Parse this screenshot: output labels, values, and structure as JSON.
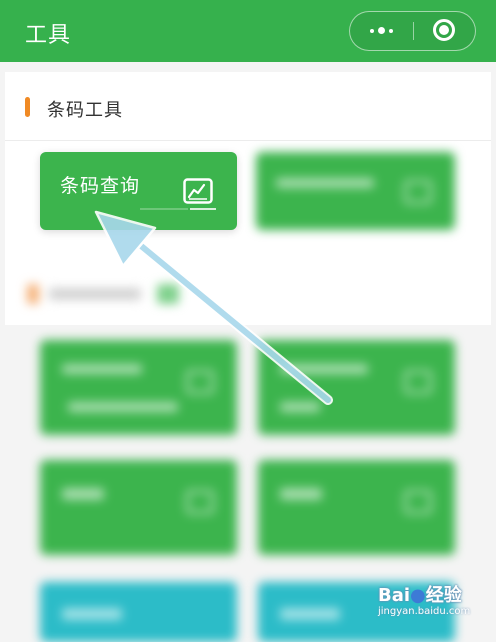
{
  "header": {
    "title": "工具",
    "more_icon": "more-dots-icon",
    "close_icon": "target-close-icon",
    "bg_color": "#36b14d"
  },
  "section": {
    "title": "条码工具",
    "accent_color": "#f08a24"
  },
  "cards": [
    {
      "label": "条码查询",
      "icon": "chart-icon",
      "color": "#3cb44d"
    }
  ],
  "annotation": {
    "arrow_color": "#a8d8ec"
  },
  "watermark": {
    "brand": "Bai",
    "suffix": "经验",
    "url": "jingyan.baidu.com"
  }
}
